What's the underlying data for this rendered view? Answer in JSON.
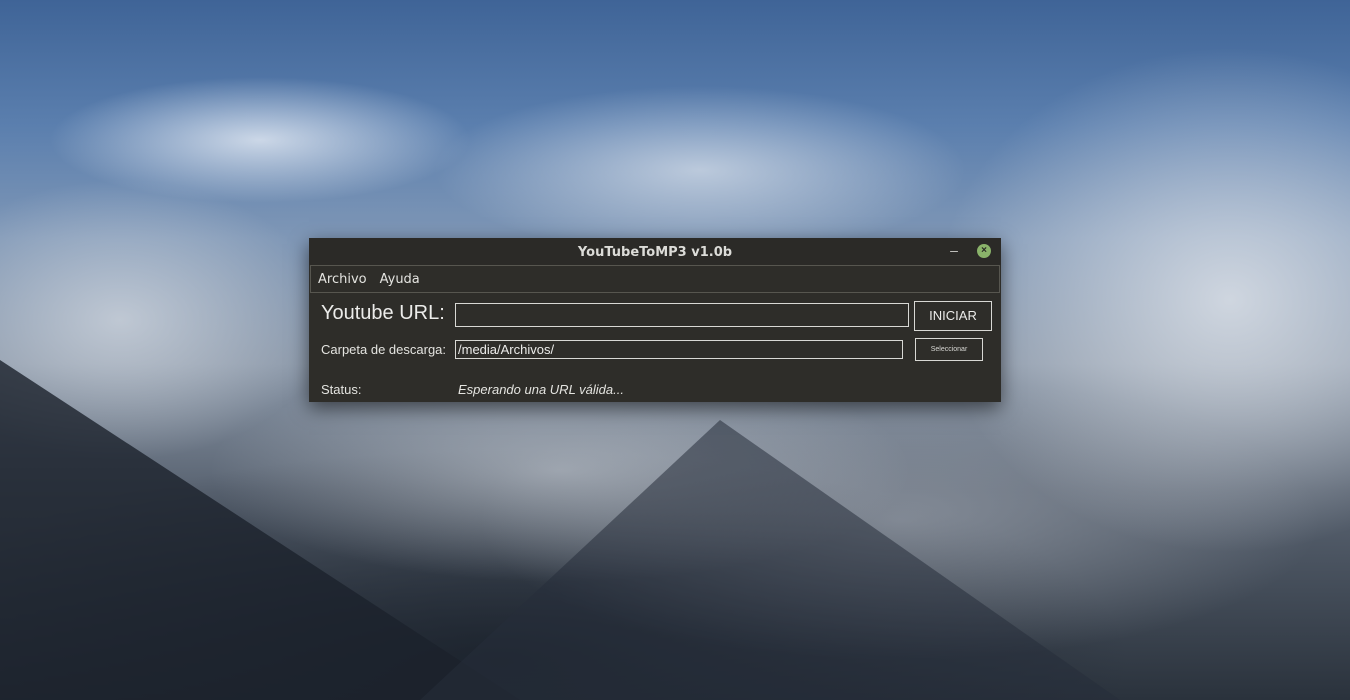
{
  "window": {
    "title": "YouTubeToMP3 v1.0b",
    "minimize_label": "–",
    "close_label": "×"
  },
  "menu": {
    "items": [
      {
        "label": "Archivo"
      },
      {
        "label": "Ayuda"
      }
    ]
  },
  "form": {
    "url_label": "Youtube URL:",
    "url_value": "",
    "start_button": "INICIAR",
    "folder_label": "Carpeta de descarga:",
    "folder_value": "/media/Archivos/",
    "select_button": "Seleccionar",
    "status_label": "Status:",
    "status_text": "Esperando una URL válida..."
  },
  "colors": {
    "window_bg": "#2e2d29",
    "close_button": "#8ab36a",
    "border": "#d8d8d4"
  }
}
